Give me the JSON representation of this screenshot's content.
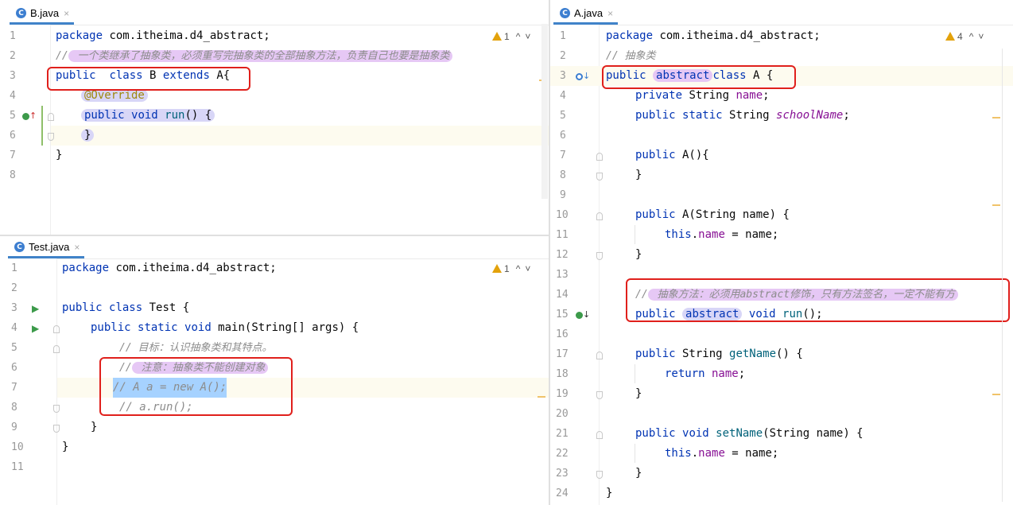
{
  "b_pane": {
    "tab": {
      "icon": "java-class-icon",
      "icon_letter": "C",
      "label": "B.java",
      "close": "×"
    },
    "warning": {
      "count": "1"
    },
    "lines": [
      "1",
      "2",
      "3",
      "4",
      "5",
      "6",
      "7",
      "8"
    ],
    "code": {
      "l1_kw": "package",
      "l1_rest": " com.itheima.d4_abstract;",
      "l2_slashes": "//",
      "l2_comment": " 一个类继承了抽象类，必须重写完抽象类的全部抽象方法，负责自己也要是抽象类",
      "l3_kw1": "public",
      "l3_kw2": "class",
      "l3_name": "B",
      "l3_kw3": "extends",
      "l3_parent": "A{",
      "l4_ann": "@Override",
      "l5_kw1": "public",
      "l5_kw2": "void",
      "l5_meth": "run",
      "l5_rest": "() {",
      "l6_brace": "}",
      "l7_brace": "}"
    }
  },
  "test_pane": {
    "tab": {
      "icon": "java-class-icon",
      "icon_letter": "C",
      "label": "Test.java",
      "close": "×"
    },
    "warning": {
      "count": "1"
    },
    "lines": [
      "1",
      "2",
      "3",
      "4",
      "5",
      "6",
      "7",
      "8",
      "9",
      "10",
      "11"
    ],
    "code": {
      "l1_kw": "package",
      "l1_rest": " com.itheima.d4_abstract;",
      "l3_kw1": "public",
      "l3_kw2": "class",
      "l3_name": " Test {",
      "l4_kw1": "public",
      "l4_kw2": "static",
      "l4_kw3": "void",
      "l4_rest": " main(String[] args) {",
      "l5_comment": "// 目标：认识抽象类和其特点。",
      "l6_slashes": "//",
      "l6_comment": " 注意：抽象类不能创建对象",
      "l7_comment": "// A a = new A();",
      "l8_comment": "// a.run();",
      "l9_brace": "}",
      "l10_brace": "}"
    }
  },
  "a_pane": {
    "tab": {
      "icon": "java-class-icon",
      "icon_letter": "C",
      "label": "A.java",
      "close": "×"
    },
    "warning": {
      "count": "4"
    },
    "lines": [
      "1",
      "2",
      "3",
      "4",
      "5",
      "6",
      "7",
      "8",
      "9",
      "10",
      "11",
      "12",
      "13",
      "14",
      "15",
      "16",
      "17",
      "18",
      "19",
      "20",
      "21",
      "22",
      "23",
      "24"
    ],
    "code": {
      "l1_kw": "package",
      "l1_rest": " com.itheima.d4_abstract;",
      "l2_comment": "// 抽象类",
      "l3_kw1": "public",
      "l3_kw2": "abstract",
      "l3_kw3": "class",
      "l3_rest": " A {",
      "l4_kw": "private",
      "l4_type": " String ",
      "l4_fld": "name",
      "l4_end": ";",
      "l5_kw1": "public",
      "l5_kw2": "static",
      "l5_type": " String ",
      "l5_fld": "schoolName",
      "l5_end": ";",
      "l7_kw": "public",
      "l7_rest": " A(){",
      "l8_brace": "}",
      "l10_kw": "public",
      "l10_rest": " A(String name) {",
      "l11_this": "this",
      "l11_dot": ".",
      "l11_fld": "name",
      "l11_rest": " = name;",
      "l12_brace": "}",
      "l14_slashes": "//",
      "l14_comment": " 抽象方法：必须用abstract修饰，只有方法签名，一定不能有方",
      "l15_kw1": "public",
      "l15_kw2": "abstract",
      "l15_kw3": "void",
      "l15_meth": " run",
      "l15_rest": "();",
      "l17_kw": "public",
      "l17_type": " String ",
      "l17_meth": "getName",
      "l17_rest": "() {",
      "l18_kw": "return",
      "l18_fld": " name",
      "l18_end": ";",
      "l19_brace": "}",
      "l21_kw1": "public",
      "l21_kw2": "void",
      "l21_meth": " setName",
      "l21_rest": "(String name) {",
      "l22_this": "this",
      "l22_dot": ".",
      "l22_fld": "name",
      "l22_rest": " = name;",
      "l23_brace": "}",
      "l24_brace": "}"
    }
  },
  "colors": {
    "keyword": "#0033b3",
    "field": "#871094",
    "comment": "#8c8c8c",
    "annotation": "#9e880d",
    "highlight_box": "#e0201c",
    "pill": "#e6c8f5"
  }
}
